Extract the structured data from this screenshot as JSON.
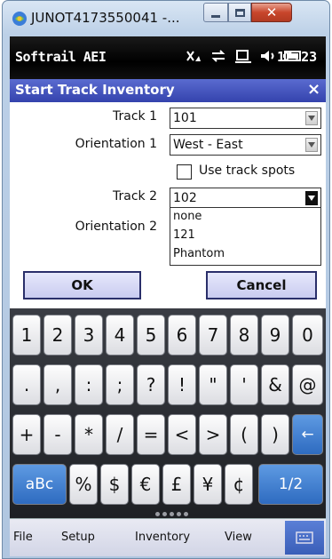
{
  "window": {
    "title": "JUNOT4173550041 -..."
  },
  "statusbar": {
    "app_name": "Softrail AEI",
    "time": "12:23",
    "icons": [
      "signal-off-icon",
      "sync-icon",
      "connectivity-icon",
      "speaker-icon",
      "battery-icon"
    ]
  },
  "dialog": {
    "title": "Start Track Inventory",
    "close_label": "×",
    "track1_label": "Track 1",
    "track1_value": "101",
    "orientation1_label": "Orientation 1",
    "orientation1_value": "West - East",
    "use_spots_label": "Use track spots",
    "use_spots_checked": false,
    "track2_label": "Track 2",
    "track2_value": "102",
    "orientation2_label": "Orientation 2",
    "dropdown_options": [
      "none",
      "121",
      "Phantom"
    ],
    "ok_label": "OK",
    "cancel_label": "Cancel"
  },
  "keyboard": {
    "row1": [
      "1",
      "2",
      "3",
      "4",
      "5",
      "6",
      "7",
      "8",
      "9",
      "0"
    ],
    "row2": [
      ".",
      ",",
      ":",
      ";",
      "?",
      "!",
      "\"",
      "'",
      "&",
      "@"
    ],
    "row3": [
      "+",
      "-",
      "*",
      "/",
      "=",
      "<",
      ">",
      "(",
      ")",
      "←"
    ],
    "row4": [
      "aBc",
      "%",
      "$",
      "€",
      "£",
      "¥",
      "¢",
      "1/2"
    ],
    "accent_color": "#3a7fd5"
  },
  "menubar": {
    "items": [
      "File",
      "Setup",
      "Inventory",
      "View"
    ]
  }
}
